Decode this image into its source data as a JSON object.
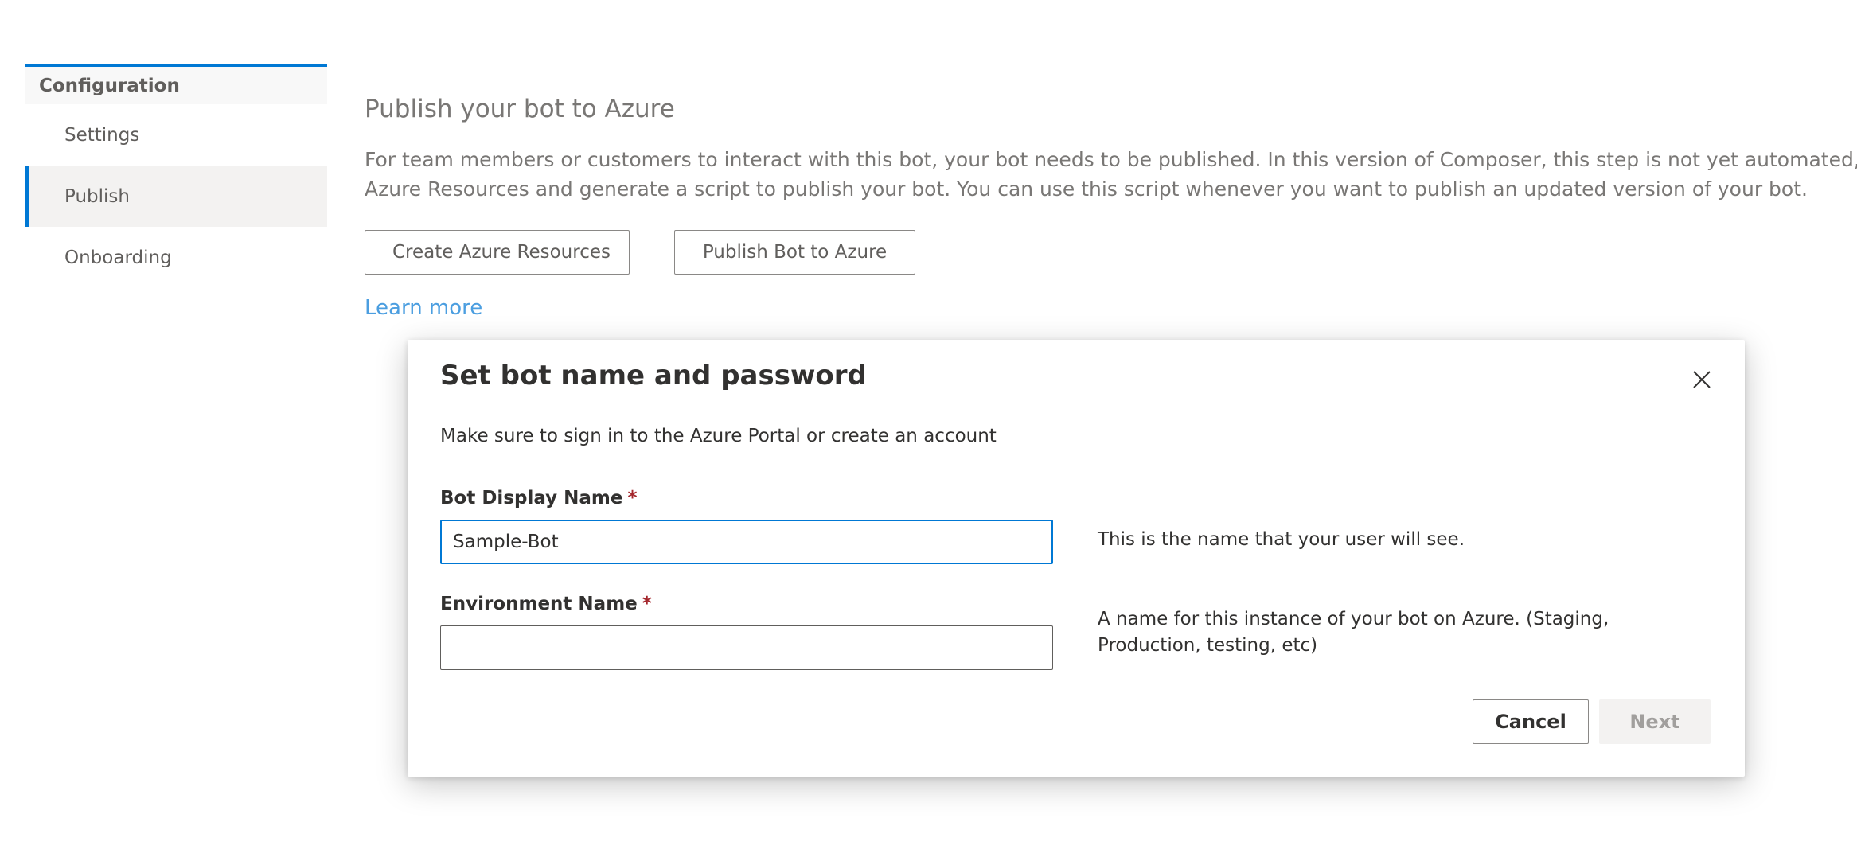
{
  "sidebar": {
    "group_label": "Configuration",
    "items": [
      {
        "label": "Settings",
        "selected": false
      },
      {
        "label": "Publish",
        "selected": true
      },
      {
        "label": "Onboarding",
        "selected": false
      }
    ]
  },
  "main": {
    "title": "Publish your bot to Azure",
    "description_line1": "For team members or customers to interact with this bot, your bot needs to be published. In this version of Composer, this step is not yet automated, ho",
    "description_line2": "Azure Resources and generate a script to publish your bot. You can use this script whenever you want to publish an updated version of your bot.",
    "create_resources_label": "Create Azure Resources",
    "publish_bot_label": "Publish Bot to Azure",
    "learn_more_label": "Learn more"
  },
  "dialog": {
    "title": "Set bot name and password",
    "subtitle": "Make sure to sign in to the Azure Portal or create an account",
    "bot_name": {
      "label": "Bot Display Name",
      "required_mark": "*",
      "value": "Sample-Bot",
      "hint": "This is the name that your user will see."
    },
    "environment_name": {
      "label": "Environment Name",
      "required_mark": "*",
      "value": "",
      "hint": "A name for this instance of your bot on Azure. (Staging, Production, testing, etc)"
    },
    "cancel_label": "Cancel",
    "next_label": "Next"
  },
  "colors": {
    "accent": "#0078d4",
    "link": "#4b9ee0",
    "required": "#a4262c",
    "disabled_bg": "#f3f2f1"
  },
  "icons": {
    "close": "close-icon"
  }
}
